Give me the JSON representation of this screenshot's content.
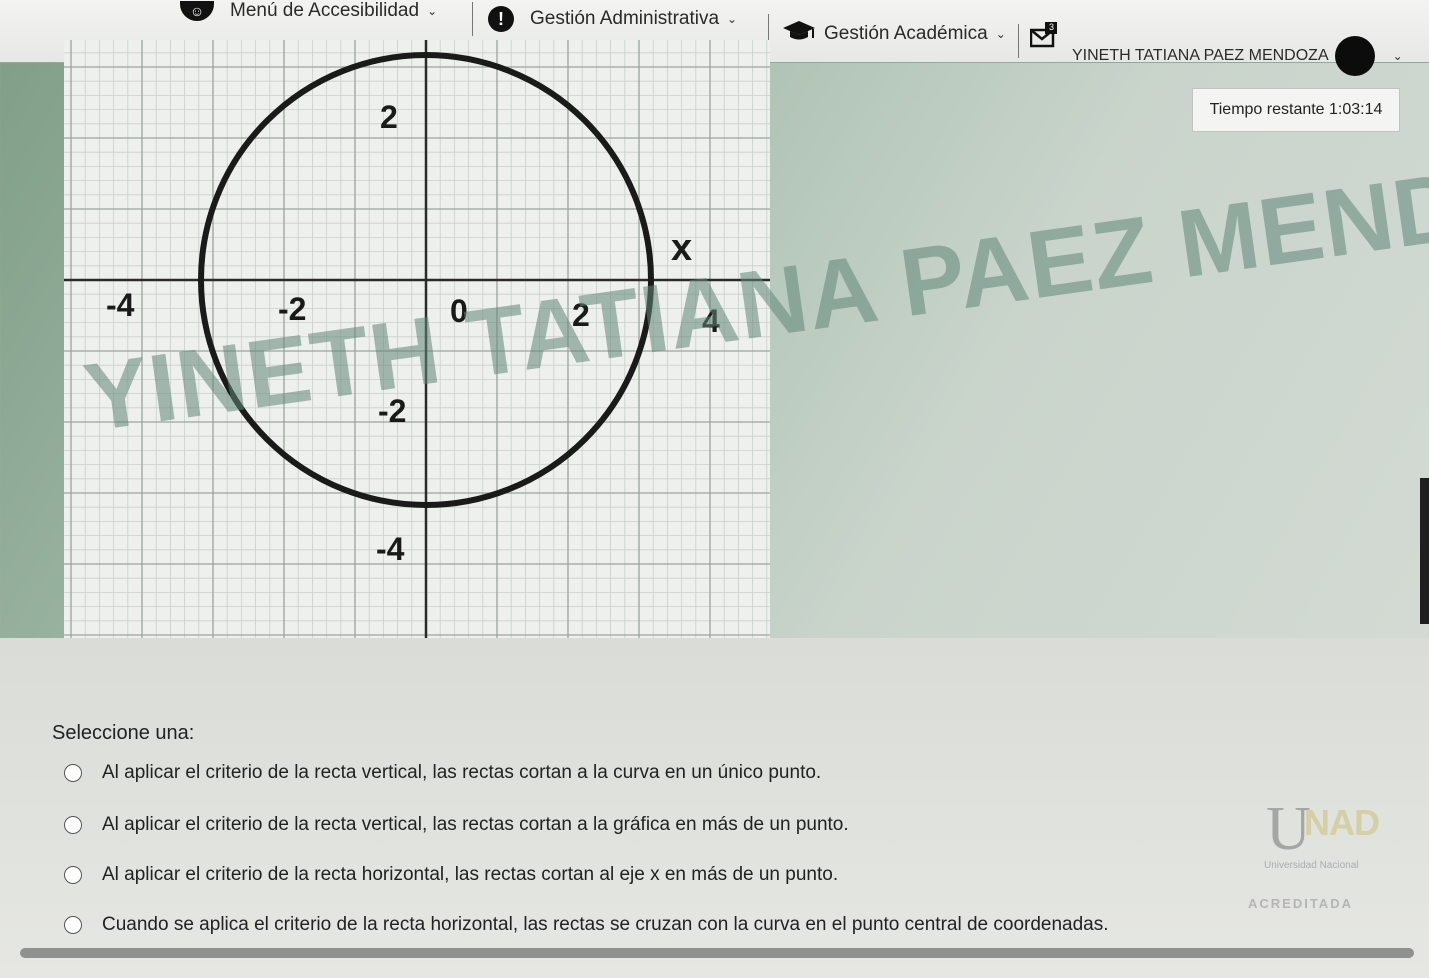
{
  "navbar": {
    "accessibility_menu": "Menú de Accesibilidad",
    "admin_menu": "Gestión Administrativa",
    "academic_menu": "Gestión Académica",
    "notification_count": "3",
    "user_name": "YINETH TATIANA PAEZ MENDOZA"
  },
  "timer": {
    "label": "Tiempo restante",
    "value": "1:03:14"
  },
  "graph": {
    "x_axis_label": "x",
    "tick_labels": {
      "x_neg4": "-4",
      "x_neg2": "-2",
      "origin": "0",
      "x_2": "2",
      "x_4": "4",
      "y_2": "2",
      "y_neg2": "-2",
      "y_neg4": "-4"
    }
  },
  "watermark": "YINETH TATIANA PAEZ MENDOZA",
  "question": {
    "prompt": "Seleccione una:",
    "options": [
      "Al aplicar el criterio de la recta vertical, las rectas cortan a la curva en un único punto.",
      "Al aplicar el criterio de la recta vertical, las rectas cortan a la gráfica en más de un punto.",
      "Al aplicar el criterio de la recta horizontal, las rectas cortan al eje x en más de un punto.",
      "Cuando se aplica el criterio de la recta horizontal, las rectas se cruzan con la curva en el punto central de coordenadas."
    ]
  },
  "logo": {
    "letter_u": "U",
    "letters_nad": "NAD",
    "subtitle": "Universidad Nacional",
    "badge": "ACREDITADA"
  }
}
